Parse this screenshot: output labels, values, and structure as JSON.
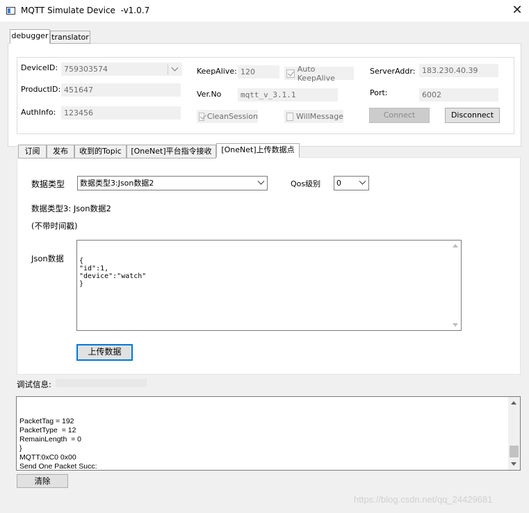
{
  "window": {
    "title": "MQTT Simulate Device  -v1.0.7",
    "close_glyph": "✕"
  },
  "main_tabs": [
    {
      "label": "debugger"
    },
    {
      "label": "translator"
    }
  ],
  "connection": {
    "device_id_label": "DeviceID:",
    "device_id_value": "759303574",
    "product_id_label": "ProductID:",
    "product_id_value": "451647",
    "auth_info_label": "AuthInfo:",
    "auth_info_value": "123456",
    "keepalive_label": "KeepAlive:",
    "keepalive_value": "120",
    "auto_keepalive_label": "Auto KeepAlive",
    "version_label": "Ver.No",
    "version_value": "mqtt_v_3.1.1",
    "clean_session_label": "CleanSession",
    "will_message_label": "WillMessage",
    "server_addr_label": "ServerAddr:",
    "server_addr_value": "183.230.40.39",
    "port_label": "Port:",
    "port_value": "6002",
    "connect_label": "Connect",
    "disconnect_label": "Disconnect"
  },
  "sub_tabs": [
    {
      "label": "订阅"
    },
    {
      "label": "发布"
    },
    {
      "label": "收到的Topic"
    },
    {
      "label": "[OneNet]平台指令接收"
    },
    {
      "label": "[OneNet]上传数据点"
    }
  ],
  "upload": {
    "data_type_label": "数据类型",
    "data_type_selected": "数据类型3:Json数据2",
    "qos_label": "Qos级别",
    "qos_selected": "0",
    "description_line1": "数据类型3: Json数据2",
    "description_line2": "(不带时间戳)",
    "json_label": "Json数据",
    "json_content": "{\n\"id\":1,\n\"device\":\"watch\"\n}",
    "upload_button": "上传数据"
  },
  "debug": {
    "label": "调试信息:",
    "log": "PacketTag = 192\nPacketType  = 12\nRemainLength  = 0\n}\nMQTT:0xC0 0x00\nSend One Packet Succ:",
    "clear_button": "清除"
  },
  "watermark": "https://blog.csdn.net/qq_24429681"
}
